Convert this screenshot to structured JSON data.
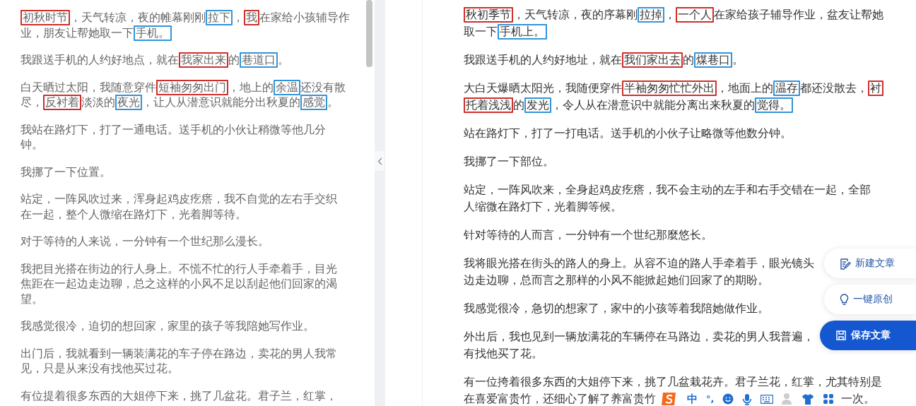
{
  "original_panel": {
    "paragraphs": [
      {
        "lines": [
          [
            {
              "text": "初秋时节",
              "color": "#cf2f2a"
            },
            {
              "text": "，天气转凉，夜的帷幕刚刚"
            },
            {
              "text": "拉下",
              "color": "#3394d8"
            },
            {
              "text": "，"
            },
            {
              "text": "我",
              "color": "#cf2f2a"
            },
            {
              "text": "在家给小孩辅导作"
            }
          ],
          [
            {
              "text": "业，朋友让帮她取一下"
            },
            {
              "text": "手机。",
              "color": "#3394d8"
            }
          ]
        ]
      },
      {
        "lines": [
          [
            {
              "text": "我跟送手机的人约好地点，就在"
            },
            {
              "text": "我家出来",
              "color": "#cf2f2a"
            },
            {
              "text": "的"
            },
            {
              "text": "巷道口",
              "color": "#3394d8"
            },
            {
              "text": "。"
            }
          ]
        ]
      },
      {
        "lines": [
          [
            {
              "text": "白天晒过太阳，我随意穿件"
            },
            {
              "text": "短袖匆匆出门",
              "color": "#cf2f2a"
            },
            {
              "text": "，地上的"
            },
            {
              "text": "余温",
              "color": "#3394d8"
            },
            {
              "text": "还没有散"
            }
          ],
          [
            {
              "text": "尽，"
            },
            {
              "text": "反衬着",
              "color": "#cf2f2a"
            },
            {
              "text": "淡淡的"
            },
            {
              "text": "夜光",
              "color": "#3394d8"
            },
            {
              "text": "，让人从潜意识就能分出秋夏的"
            },
            {
              "text": "感觉",
              "color": "#3394d8"
            },
            {
              "text": "。"
            }
          ]
        ]
      },
      {
        "lines": [
          [
            {
              "text": "我站在路灯下，打了一通电话。送手机的小伙让稍微等他几分"
            }
          ],
          [
            {
              "text": "钟。"
            }
          ]
        ]
      },
      {
        "lines": [
          [
            {
              "text": "我挪了一下位置。"
            }
          ]
        ]
      },
      {
        "lines": [
          [
            {
              "text": "站定，一阵风吹过来，浑身起鸡皮疙瘩，我不自觉的左右手交织"
            }
          ],
          [
            {
              "text": "在一起，整个人微缩在路灯下，光着脚等待。"
            }
          ]
        ]
      },
      {
        "lines": [
          [
            {
              "text": "对于等待的人来说，一分钟有一个世纪那么漫长。"
            }
          ]
        ]
      },
      {
        "lines": [
          [
            {
              "text": "我把目光搭在街边的行人身上。不慌不忙的行人手牵着手，目光"
            }
          ],
          [
            {
              "text": "焦距在一起边走边聊，总之这样的小风不足以刮起他们回家的渴"
            }
          ],
          [
            {
              "text": "望。"
            }
          ]
        ]
      },
      {
        "lines": [
          [
            {
              "text": "我感觉很冷，迫切的想回家，家里的孩子等我陪她写作业。"
            }
          ]
        ]
      },
      {
        "lines": [
          [
            {
              "text": "出门后，我就看到一辆装满花的车子停在路边，卖花的男人我常"
            }
          ],
          [
            {
              "text": "见，只是从来没有找他买过花。"
            }
          ]
        ]
      },
      {
        "lines": [
          [
            {
              "text": "有位提着很多东西的大姐停下来，挑了几盆花。君子兰，红掌，"
            }
          ]
        ]
      }
    ]
  },
  "rewritten_panel": {
    "paragraphs": [
      {
        "lines": [
          [
            {
              "text": "秋初季节",
              "color": "#cf2f2a"
            },
            {
              "text": "，天气转凉，夜的序幕刚"
            },
            {
              "text": "拉掉",
              "color": "#3394d8"
            },
            {
              "text": "，"
            },
            {
              "text": "一个人",
              "color": "#cf2f2a"
            },
            {
              "text": "在家给孩子辅导作业，盆友让帮她"
            }
          ],
          [
            {
              "text": "取一下"
            },
            {
              "text": "手机上。",
              "color": "#3394d8"
            }
          ]
        ]
      },
      {
        "lines": [
          [
            {
              "text": "我跟送手机的人约好地址，就在"
            },
            {
              "text": "我们家出去",
              "color": "#cf2f2a"
            },
            {
              "text": "的"
            },
            {
              "text": "煤巷口",
              "color": "#3394d8"
            },
            {
              "text": "。"
            }
          ]
        ]
      },
      {
        "lines": [
          [
            {
              "text": "大白天爆晒太阳光，我随便穿件"
            },
            {
              "text": "半袖匆匆忙忙外出",
              "color": "#cf2f2a"
            },
            {
              "text": "，地面上的"
            },
            {
              "text": "温存",
              "color": "#3394d8"
            },
            {
              "text": "都还没散去，"
            },
            {
              "text": "衬",
              "color": "#cf2f2a"
            }
          ],
          [
            {
              "text": "托着浅浅",
              "color": "#cf2f2a"
            },
            {
              "text": "的"
            },
            {
              "text": "发光",
              "color": "#3394d8"
            },
            {
              "text": "，令人从在潜意识中就能分离出来秋夏的"
            },
            {
              "text": "觉得。",
              "color": "#3394d8"
            }
          ]
        ]
      },
      {
        "lines": [
          [
            {
              "text": "站在路灯下，打了一打电话。送手机的小伙子让略微等他数分钟。"
            }
          ]
        ]
      },
      {
        "lines": [
          [
            {
              "text": "我挪了一下部位。"
            }
          ]
        ]
      },
      {
        "lines": [
          [
            {
              "text": "站定，一阵风吹来，全身起鸡皮疙瘩，我不会主动的左手和右手交错在一起，全部"
            }
          ],
          [
            {
              "text": "人缩微在路灯下，光着脚等候。"
            }
          ]
        ]
      },
      {
        "lines": [
          [
            {
              "text": "针对等待的人而言，一分钟有一个世纪那麼悠长。"
            }
          ]
        ]
      },
      {
        "lines": [
          [
            {
              "text": "我将眼光搭在街头的路人的身上。从容不迫的路人手牵着手，眼光镜头"
            }
          ],
          [
            {
              "text": "边走边聊，总而言之那样的小风不能掀起她们回家了的期盼。"
            }
          ]
        ]
      },
      {
        "lines": [
          [
            {
              "text": "我感觉很冷，急切的想家了，家中的小孩等着我陪她做作业。"
            }
          ]
        ]
      },
      {
        "lines": [
          [
            {
              "text": "外出后，我也见到一辆放满花的车辆停在马路边，卖花的男人我普遍，"
            }
          ],
          [
            {
              "text": "有找他买了花。"
            }
          ]
        ]
      },
      {
        "lines": [
          [
            {
              "text": "有一位挎着很多东西的大姐停下来，挑了几盆栽花卉。君子兰花，红掌，尤其特别是"
            }
          ],
          [
            {
              "text": "在喜爱富贵竹，还细心了解了养富贵竹"
            },
            {
              "text": "一次。",
              "kind": "after_overlay"
            }
          ]
        ]
      }
    ]
  },
  "actions": [
    {
      "label": "新建文章",
      "primary": false
    },
    {
      "label": "一键原创",
      "primary": false
    },
    {
      "label": "保存文章",
      "primary": true
    }
  ],
  "ime_toolbar": {
    "mode": "中",
    "punctuation": "°,"
  }
}
